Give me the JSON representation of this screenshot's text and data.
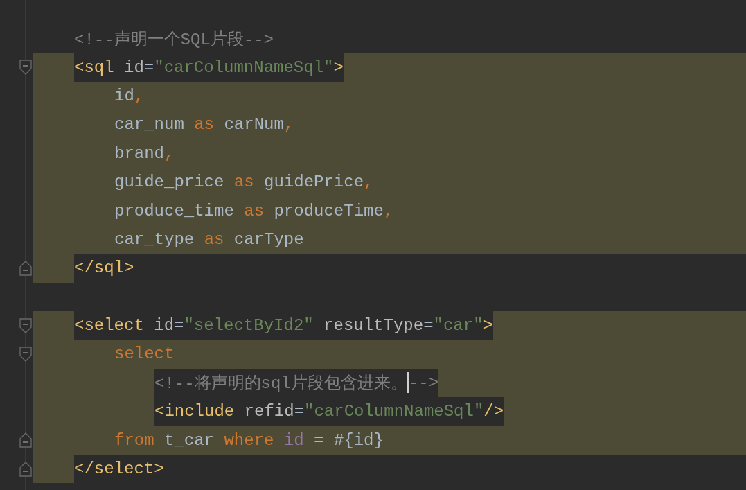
{
  "blocks": [
    {
      "lines": [
        {
          "kind": "plain",
          "tokens": [
            {
              "kind": "comment",
              "text": "<!--声明一个SQL片段-->"
            }
          ]
        },
        {
          "kind": "tail",
          "fold_start": true,
          "tokens": [
            {
              "kind": "tag",
              "text": "<sql"
            },
            {
              "kind": "attr",
              "text": " id"
            },
            {
              "kind": "plain",
              "text": "="
            },
            {
              "kind": "string",
              "text": "\"carColumnNameSql\""
            },
            {
              "kind": "tag",
              "text": ">"
            }
          ],
          "children": [
            {
              "kind": "full",
              "tokens": [
                {
                  "kind": "plain",
                  "text": "id"
                },
                {
                  "kind": "punct",
                  "text": ","
                }
              ]
            },
            {
              "kind": "full",
              "tokens": [
                {
                  "kind": "plain",
                  "text": "car_num "
                },
                {
                  "kind": "keyword",
                  "text": "as"
                },
                {
                  "kind": "plain",
                  "text": " carNum"
                },
                {
                  "kind": "punct",
                  "text": ","
                }
              ]
            },
            {
              "kind": "full",
              "tokens": [
                {
                  "kind": "plain",
                  "text": "brand"
                },
                {
                  "kind": "punct",
                  "text": ","
                }
              ]
            },
            {
              "kind": "full",
              "tokens": [
                {
                  "kind": "plain",
                  "text": "guide_price "
                },
                {
                  "kind": "keyword",
                  "text": "as"
                },
                {
                  "kind": "plain",
                  "text": " guidePrice"
                },
                {
                  "kind": "punct",
                  "text": ","
                }
              ]
            },
            {
              "kind": "full",
              "tokens": [
                {
                  "kind": "plain",
                  "text": "produce_time "
                },
                {
                  "kind": "keyword",
                  "text": "as"
                },
                {
                  "kind": "plain",
                  "text": " produceTime"
                },
                {
                  "kind": "punct",
                  "text": ","
                }
              ]
            },
            {
              "kind": "full",
              "tokens": [
                {
                  "kind": "plain",
                  "text": "car_type "
                },
                {
                  "kind": "keyword",
                  "text": "as"
                },
                {
                  "kind": "plain",
                  "text": " carType"
                }
              ]
            }
          ]
        },
        {
          "kind": "head",
          "fold_end": true,
          "tokens": [
            {
              "kind": "tag",
              "text": "</sql>"
            }
          ]
        }
      ]
    },
    {
      "lines": [
        {
          "kind": "tail",
          "fold_start": true,
          "tokens": [
            {
              "kind": "tag",
              "text": "<select"
            },
            {
              "kind": "attr",
              "text": " id"
            },
            {
              "kind": "plain",
              "text": "="
            },
            {
              "kind": "string",
              "text": "\"selectById2\""
            },
            {
              "kind": "attr",
              "text": " resultType"
            },
            {
              "kind": "plain",
              "text": "="
            },
            {
              "kind": "string",
              "text": "\"car\""
            },
            {
              "kind": "tag",
              "text": ">"
            }
          ],
          "children": [
            {
              "kind": "full",
              "fold_start": true,
              "tokens": [
                {
                  "kind": "keyword",
                  "text": "select"
                }
              ],
              "children": [
                {
                  "kind": "boxed",
                  "tokens": [
                    {
                      "kind": "comment",
                      "text": "<!--将声明的sql片段包含进来。",
                      "caret": true
                    },
                    {
                      "kind": "comment",
                      "text": "-->"
                    }
                  ]
                },
                {
                  "kind": "boxed",
                  "tokens": [
                    {
                      "kind": "tag",
                      "text": "<include"
                    },
                    {
                      "kind": "attr",
                      "text": " refid"
                    },
                    {
                      "kind": "plain",
                      "text": "="
                    },
                    {
                      "kind": "string",
                      "text": "\"carColumnNameSql\""
                    },
                    {
                      "kind": "tag",
                      "text": "/>"
                    }
                  ]
                }
              ]
            },
            {
              "kind": "full",
              "fold_end": true,
              "tokens": [
                {
                  "kind": "keyword",
                  "text": "from"
                },
                {
                  "kind": "plain",
                  "text": " t_car "
                },
                {
                  "kind": "keyword",
                  "text": "where"
                },
                {
                  "kind": "var",
                  "text": " id"
                },
                {
                  "kind": "plain",
                  "text": " = #{id}"
                }
              ]
            }
          ]
        },
        {
          "kind": "head",
          "fold_end": true,
          "tokens": [
            {
              "kind": "tag",
              "text": "</select>"
            }
          ]
        }
      ]
    }
  ]
}
